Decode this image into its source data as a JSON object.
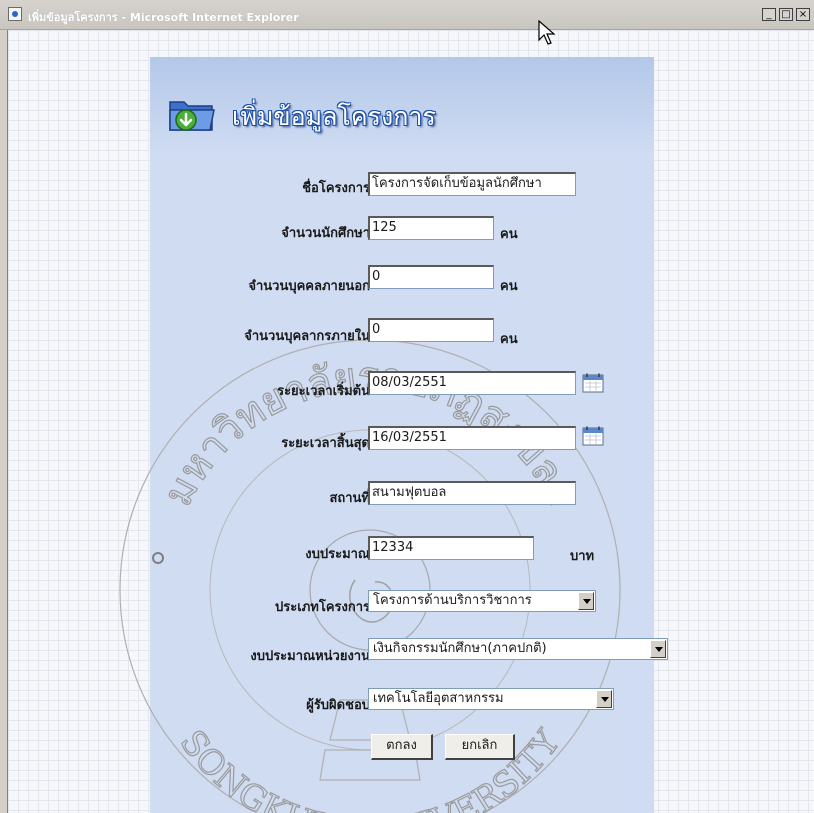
{
  "window": {
    "title": "เพิ่มข้อมูลโครงการ - Microsoft Internet Explorer",
    "controls": {
      "minimize": "_",
      "maximize": "□",
      "close": "×"
    }
  },
  "form": {
    "header_title": "เพิ่มข้อมูลโครงการ",
    "project_name": {
      "label": "ชื่อโครงการ",
      "value": "โครงการจัดเก็บข้อมูลนักศึกษา"
    },
    "student_count": {
      "label": "จำนวนนักศึกษา",
      "value": "125",
      "unit": "คน"
    },
    "external_count": {
      "label": "จำนวนบุคคลภายนอก",
      "value": "0",
      "unit": "คน"
    },
    "internal_count": {
      "label": "จำนวนบุคลากรภายใน",
      "value": "0",
      "unit": "คน"
    },
    "start_date": {
      "label": "ระยะเวลาเริ่มต้น",
      "value": "08/03/2551",
      "icon": "calendar-icon"
    },
    "end_date": {
      "label": "ระยะเวลาสิ้นสุด",
      "value": "16/03/2551",
      "icon": "calendar-icon"
    },
    "location": {
      "label": "สถานที่",
      "value": "สนามฟุตบอล"
    },
    "budget": {
      "label": "งบประมาณ",
      "value": "12334",
      "unit": "บาท"
    },
    "project_type": {
      "label": "ประเภทโครงการ",
      "value": "โครงการด้านบริการวิชาการ"
    },
    "budget_unit": {
      "label": "งบประมาณหน่วยงาน",
      "value": "เงินกิจกรรมนักศึกษา(ภาคปกติ)"
    },
    "responsible": {
      "label": "ผู้รับผิดชอบ",
      "value": "เทคโนโลยีอุตสาหกรรม"
    },
    "ok_button": "ตกลง",
    "cancel_button": "ยกเลิก"
  },
  "watermark": {
    "top": "มหาวิทยาลัยราชภัฏสงขลา",
    "bottom": "SONGKHLA UNIVERSITY"
  }
}
